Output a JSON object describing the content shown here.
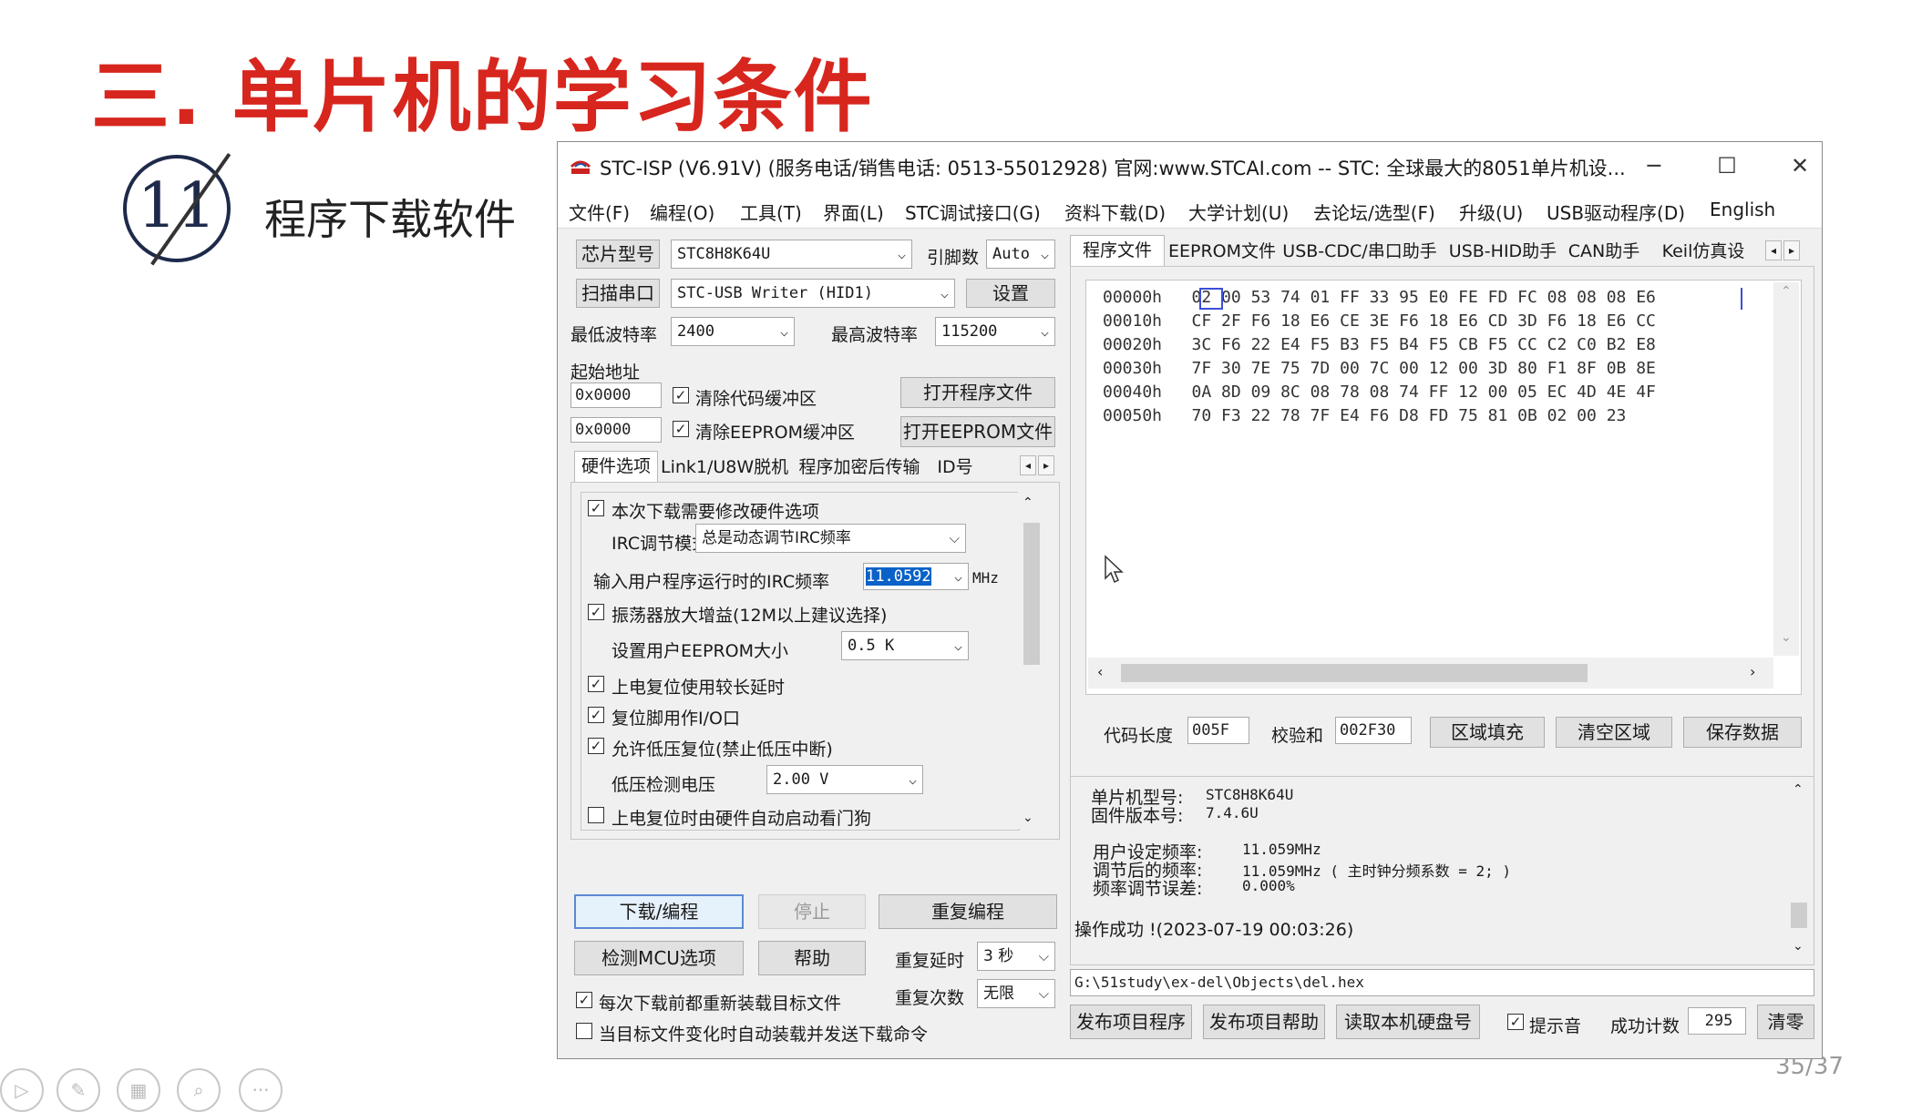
{
  "slide": {
    "title": "三. 单片机的学习条件",
    "number": "11",
    "subtitle": "程序下载软件",
    "page": "35/37"
  },
  "window": {
    "title": "STC-ISP (V6.91V) (服务电话/销售电话: 0513-55012928) 官网:www.STCAI.com  -- STC: 全球最大的8051单片机设...",
    "menu": [
      "文件(F)",
      "编程(O)",
      "工具(T)",
      "界面(L)",
      "STC调试接口(G)",
      "资料下载(D)",
      "大学计划(U)",
      "去论坛/选型(F)",
      "升级(U)",
      "USB驱动程序(D)",
      "English"
    ]
  },
  "left": {
    "chip_type_button": "芯片型号",
    "chip_type_value": "STC8H8K64U",
    "pins_label": "引脚数",
    "pins_value": "Auto",
    "scan_port_button": "扫描串口",
    "port_value": "STC-USB Writer (HID1)",
    "settings_button": "设置",
    "min_baud_label": "最低波特率",
    "min_baud_value": "2400",
    "max_baud_label": "最高波特率",
    "max_baud_value": "115200",
    "start_addr_label": "起始地址",
    "addr1": "0x0000",
    "clear_code_label": "清除代码缓冲区",
    "open_program_button": "打开程序文件",
    "addr2": "0x0000",
    "clear_eeprom_label": "清除EEPROM缓冲区",
    "open_eeprom_button": "打开EEPROM文件",
    "tabs": [
      "硬件选项",
      "Link1/U8W脱机",
      "程序加密后传输",
      "ID号"
    ],
    "hw": {
      "modify_hw": "本次下载需要修改硬件选项",
      "irc_mode_label": "IRC调节模式",
      "irc_mode_value": "总是动态调节IRC频率",
      "irc_freq_label": "输入用户程序运行时的IRC频率",
      "irc_freq_value": "11.0592",
      "irc_freq_unit": "MHz",
      "osc_gain": "振荡器放大增益(12M以上建议选择)",
      "eeprom_size_label": "设置用户EEPROM大小",
      "eeprom_size_value": "0.5 K",
      "long_delay": "上电复位使用较长延时",
      "reset_io": "复位脚用作I/O口",
      "low_volt_reset": "允许低压复位(禁止低压中断)",
      "low_volt_label": "低压检测电压",
      "low_volt_value": "2.00 V",
      "watchdog": "上电复位时由硬件自动启动看门狗"
    },
    "download_button": "下载/编程",
    "stop_button": "停止",
    "reprogram_button": "重复编程",
    "check_mcu_button": "检测MCU选项",
    "help_button": "帮助",
    "repeat_delay_label": "重复延时",
    "repeat_delay_value": "3 秒",
    "repeat_count_label": "重复次数",
    "repeat_count_value": "无限",
    "reload_label": "每次下载前都重新装载目标文件",
    "auto_load_label": "当目标文件变化时自动装载并发送下载命令"
  },
  "right": {
    "tabs": [
      "程序文件",
      "EEPROM文件",
      "USB-CDC/串口助手",
      "USB-HID助手",
      "CAN助手",
      "Keil仿真设"
    ],
    "hex_rows": [
      {
        "addr": "00000h",
        "bytes": "02 00 53 74 01 FF 33 95 E0 FE FD FC 08 08 08 E6"
      },
      {
        "addr": "00010h",
        "bytes": "CF 2F F6 18 E6 CE 3E F6 18 E6 CD 3D F6 18 E6 CC"
      },
      {
        "addr": "00020h",
        "bytes": "3C F6 22 E4 F5 B3 F5 B4 F5 CB F5 CC C2 C0 B2 E8"
      },
      {
        "addr": "00030h",
        "bytes": "7F 30 7E 75 7D 00 7C 00 12 00 3D 80 F1 8F 0B 8E"
      },
      {
        "addr": "00040h",
        "bytes": "0A 8D 09 8C 08 78 08 74 FF 12 00 05 EC 4D 4E 4F"
      },
      {
        "addr": "00050h",
        "bytes": "70 F3 22 78 7F E4 F6 D8 FD 75 81 0B 02 00 23"
      }
    ],
    "code_len_label": "代码长度",
    "code_len_value": "005F",
    "checksum_label": "校验和",
    "checksum_value": "002F30",
    "fill_button": "区域填充",
    "clear_button": "清空区域",
    "save_button": "保存数据",
    "log": {
      "mcu_label": "单片机型号:",
      "mcu_value": "STC8H8K64U",
      "fw_label": "固件版本号:",
      "fw_value": "7.4.6U",
      "user_freq_label": "用户设定频率:",
      "user_freq_value": "11.059MHz",
      "adj_freq_label": "调节后的频率:",
      "adj_freq_value": "11.059MHz ( 主时钟分频系数 = 2; )",
      "err_label": "频率调节误差:",
      "err_value": "0.000%",
      "success": "操作成功 !(2023-07-19 00:03:26)"
    },
    "path": "G:\\51study\\ex-del\\Objects\\del.hex",
    "publish_program_button": "发布项目程序",
    "publish_help_button": "发布项目帮助",
    "read_disk_button": "读取本机硬盘号",
    "sound_label": "提示音",
    "success_count_label": "成功计数",
    "success_count_value": "295",
    "clear_count_button": "清零"
  }
}
